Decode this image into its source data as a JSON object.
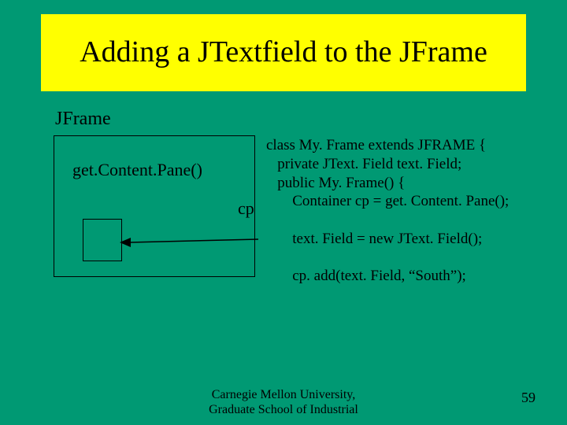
{
  "title": "Adding a JTextfield to the JFrame",
  "jframe_label": "JFrame",
  "gcp_label": "get.Content.Pane()",
  "cp_label": "cp",
  "code": {
    "l1": "class My. Frame extends JFRAME {",
    "l2": "   private JText. Field text. Field;",
    "l3": "   public My. Frame() {",
    "l4": "       Container cp = get. Content. Pane();",
    "l5": "",
    "l6": "       text. Field = new JText. Field();",
    "l7": "",
    "l8": "       cp. add(text. Field, “South”);"
  },
  "footer": {
    "line1": "Carnegie Mellon University,",
    "line2": "Graduate School of Industrial"
  },
  "page_number": "59"
}
